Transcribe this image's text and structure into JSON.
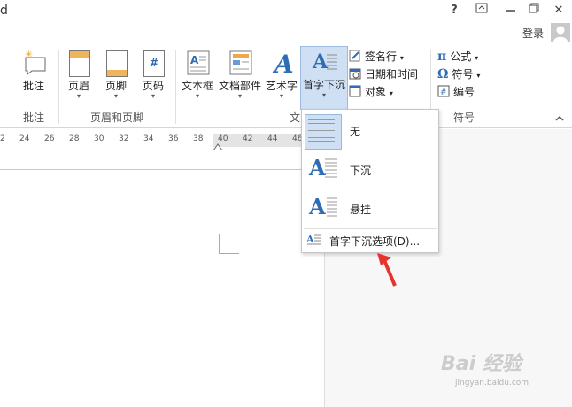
{
  "titlebar": {
    "app_fragment": "d",
    "help": "?",
    "restore_ribbon": "⊡",
    "restore": "❐",
    "close": "✕"
  },
  "account": {
    "login_label": "登录"
  },
  "ribbon": {
    "comment_group": {
      "label": "批注",
      "button": "批注"
    },
    "header_footer_group": {
      "label": "页眉和页脚",
      "header": "页眉",
      "footer": "页脚",
      "page_number": "页码"
    },
    "text_group": {
      "label_fragment": "文",
      "textbox": "文本框",
      "quick_parts": "文档部件",
      "wordart": "艺术字",
      "dropcap": "首字下沉",
      "signature_line": "签名行",
      "datetime": "日期和时间",
      "object": "对象"
    },
    "symbols_group": {
      "label": "符号",
      "equation": "公式",
      "symbol": "符号",
      "number": "编号"
    },
    "collapse": "^"
  },
  "ruler": {
    "ticks": [
      "2",
      "24",
      "26",
      "28",
      "30",
      "32",
      "34",
      "36",
      "38",
      "40",
      "42",
      "44",
      "46"
    ]
  },
  "dropdown": {
    "items": [
      {
        "label": "无"
      },
      {
        "label": "下沉"
      },
      {
        "label": "悬挂"
      }
    ],
    "options_label": "首字下沉选项(D)...",
    "options_hotkey": "D"
  },
  "watermark": {
    "brand": "Bai 经验",
    "url": "jingyan.baidu.com"
  },
  "colors": {
    "accent": "#2e6db4",
    "selected_bg": "#cfe0f4",
    "arrow": "#e8322c"
  }
}
